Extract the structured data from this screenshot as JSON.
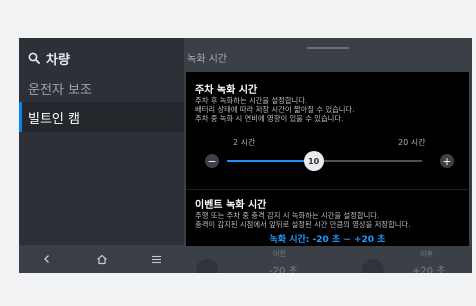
{
  "sidebar": {
    "search_label": "차량",
    "items": [
      {
        "label": "운전자 보조"
      },
      {
        "label": "빌트인 캠"
      }
    ],
    "nav": {
      "back_icon": "back-icon",
      "home_icon": "home-icon",
      "menu_icon": "menu-icon"
    }
  },
  "header": {
    "title": "녹화 시간"
  },
  "popup": {
    "parking": {
      "title": "주차 녹화 시간",
      "desc_lines": [
        "주차 후 녹화하는 시간을 설정합니다.",
        "배터리 상태에 따라 저장 시간이 짧아질 수 있습니다.",
        "주차 중 녹화 시 연비에 영향이 있을 수 있습니다."
      ],
      "min_label": "2 시간",
      "max_label": "20 시간",
      "value": "10",
      "min": 2,
      "max": 20,
      "current": 10,
      "minus": "−",
      "plus": "+"
    },
    "event": {
      "title": "이벤트 녹화 시간",
      "desc_lines": [
        "주행 또는 주차 중 충격 감지 시 녹화하는 시간을 설정합니다.",
        "충격이 감지된 시점에서 앞뒤로 설정된 시간 만큼의 영상을 저장합니다."
      ],
      "note": "녹화 시간: -20 초 ~ +20 초"
    }
  },
  "background": {
    "before_label": "이전",
    "after_label": "이후",
    "before_value": "-20 초",
    "after_value": "+20 초"
  },
  "colors": {
    "accent": "#1f8ef0",
    "note": "#1f9cff"
  }
}
